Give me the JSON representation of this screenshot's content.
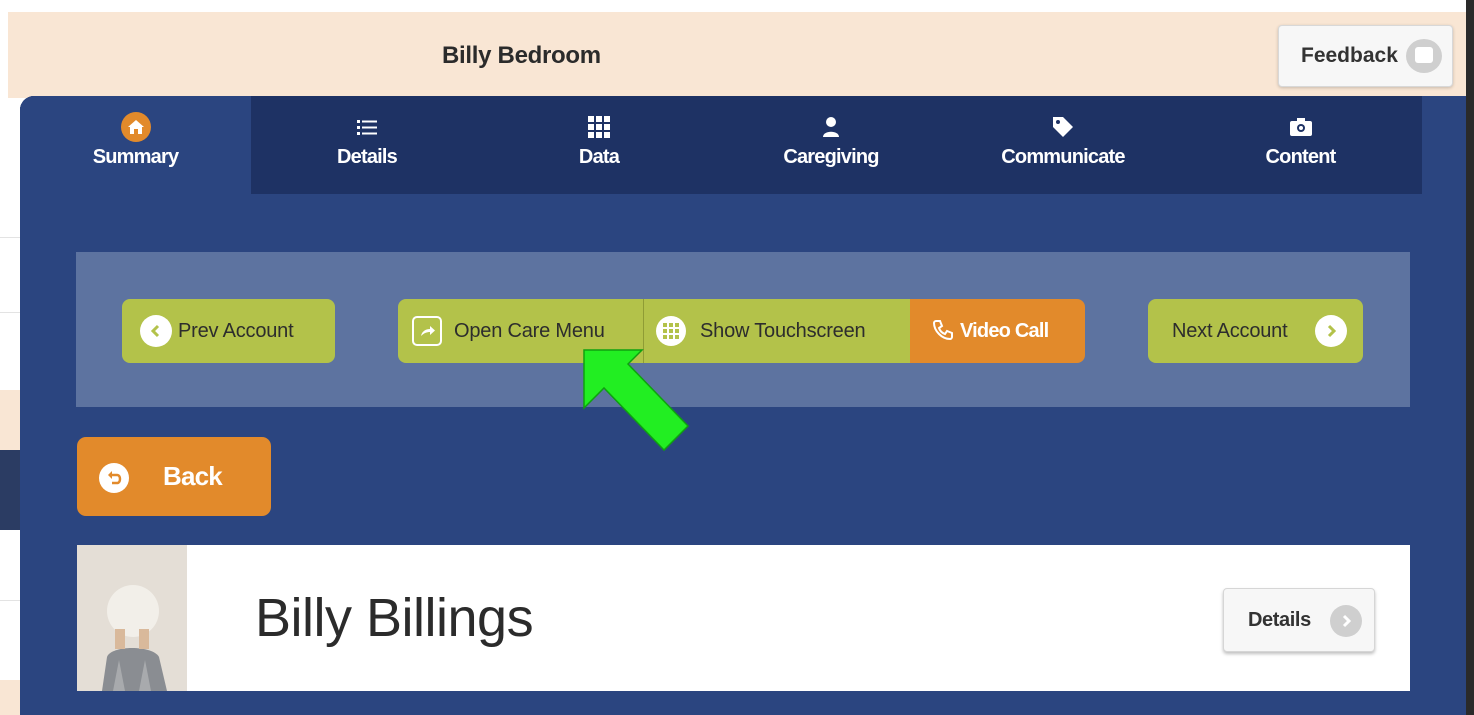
{
  "header": {
    "title": "Billy Bedroom",
    "feedback_label": "Feedback"
  },
  "tabs": [
    {
      "label": "Summary",
      "icon": "home-icon",
      "active": true
    },
    {
      "label": "Details",
      "icon": "list-icon",
      "active": false
    },
    {
      "label": "Data",
      "icon": "grid-icon",
      "active": false
    },
    {
      "label": "Caregiving",
      "icon": "person-icon",
      "active": false
    },
    {
      "label": "Communicate",
      "icon": "tag-icon",
      "active": false
    },
    {
      "label": "Content",
      "icon": "camera-icon",
      "active": false
    }
  ],
  "toolbar": {
    "prev_account": "Prev Account",
    "open_care_menu": "Open Care Menu",
    "show_touchscreen": "Show Touchscreen",
    "video_call": "Video Call",
    "next_account": "Next Account"
  },
  "back_label": "Back",
  "profile": {
    "name": "Billy Billings",
    "details_label": "Details"
  },
  "colors": {
    "panel_blue": "#2b4580",
    "tab_bar": "#1e3264",
    "toolbar_bg": "#5d73a0",
    "button_green": "#b3c24a",
    "accent_orange": "#e28a2b",
    "header_beige": "#f9e6d4",
    "annotation_arrow": "#22ee22"
  }
}
